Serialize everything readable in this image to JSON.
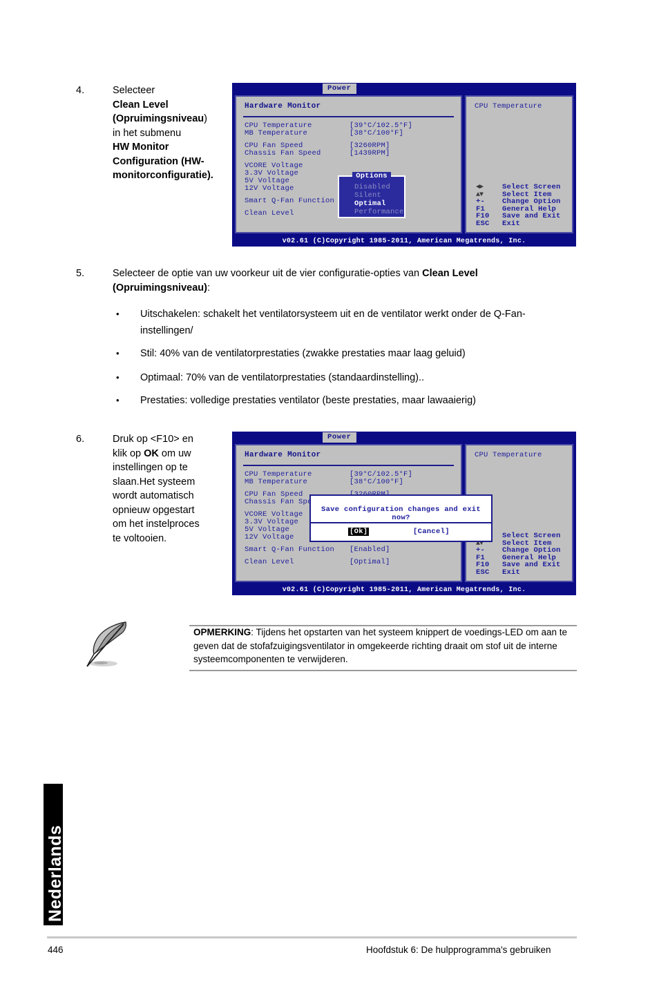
{
  "page": {
    "number": "446",
    "chapter": "Hoofdstuk 6: De hulpprogramma's gebruiken",
    "language_tab": "Nederlands"
  },
  "steps": {
    "step4": {
      "number": "4.",
      "line1": "Selecteer",
      "line2_bold": "Clean Level",
      "line3_bold": "(Opruimingsniveau",
      "line3_tail": ")",
      "line4": "in het submenu",
      "line5_bold": "HW Monitor",
      "line6_bold": "Configuration (HW-",
      "line7_bold": "monitorconfiguratie",
      "line7_tail": ")."
    },
    "step5": {
      "number": "5.",
      "text_pre": "Selecteer de optie van uw voorkeur uit de vier configuratie-opties van ",
      "text_bold1": "Clean Level",
      "text_bold2": "(Opruimingsniveau)",
      "text_post": ":",
      "bullets": [
        "Uitschakelen: schakelt het ventilatorsysteem uit en de ventilator werkt onder de Q-Fan-instellingen/",
        "Stil: 40% van de ventilatorprestaties (zwakke prestaties maar laag geluid)",
        "Optimaal: 70% van de ventilatorprestaties (standaardinstelling)..",
        "Prestaties: volledige prestaties ventilator (beste prestaties, maar lawaaierig)"
      ],
      "bullet_mark": "•"
    },
    "step6": {
      "number": "6.",
      "line1_pre": "Druk op <F10> en",
      "line2_pre": "klik op ",
      "line2_bold": "OK",
      "line2_post": " om uw",
      "line3": "instellingen op te",
      "line4": "slaan.Het systeem",
      "line5": "wordt automatisch",
      "line6": "opnieuw opgestart",
      "line7": "om het instelproces",
      "line8": "te voltooien."
    }
  },
  "note": {
    "label": "OPMERKING",
    "text": ": Tijdens het opstarten van het systeem knippert de voedings-LED om aan te geven dat de stofafzuigingsventilator in omgekeerde richting draait om stof uit de interne systeemcomponenten te verwijderen."
  },
  "bios": {
    "tab_label": "Power",
    "panel_title": "Hardware Monitor",
    "help_title": "CPU Temperature",
    "copyright": "v02.61 (C)Copyright 1985-2011, American Megatrends, Inc.",
    "monitor_rows": [
      {
        "label": "CPU Temperature",
        "value": "[39°C/102.5°F]"
      },
      {
        "label": "MB Temperature",
        "value": "[38°C/100°F]"
      },
      {
        "label": "CPU Fan Speed",
        "value": "[3260RPM]"
      },
      {
        "label": "Chassis Fan Speed",
        "value": "[1439RPM]"
      },
      {
        "label": "VCORE Voltage",
        "value": ""
      },
      {
        "label": "3.3V Voltage",
        "value": ""
      },
      {
        "label": "5V Voltage",
        "value": ""
      },
      {
        "label": "12V Voltage",
        "value": ""
      },
      {
        "label": "Smart Q-Fan Function",
        "value": "[Enabled]"
      },
      {
        "label": "Clean Level",
        "value": "[Optimal]"
      }
    ],
    "legend": [
      {
        "glyph": "◄►",
        "key": "",
        "text": "Select Screen"
      },
      {
        "glyph": "▲▼",
        "key": "",
        "text": "Select Item"
      },
      {
        "glyph": "",
        "key": "+-",
        "text": "Change Option"
      },
      {
        "glyph": "",
        "key": "F1",
        "text": "General Help"
      },
      {
        "glyph": "",
        "key": "F10",
        "text": "Save and Exit"
      },
      {
        "glyph": "",
        "key": "ESC",
        "text": "Exit"
      }
    ],
    "options_popup": {
      "title": "Options",
      "items": [
        {
          "label": "Disabled",
          "selected": false
        },
        {
          "label": "Silent",
          "selected": false
        },
        {
          "label": "Optimal",
          "selected": true
        },
        {
          "label": "Performance",
          "selected": false
        }
      ]
    },
    "save_dialog": {
      "message": "Save configuration changes and exit now?",
      "ok_label": "[Ok]",
      "cancel_label": "[Cancel]"
    }
  },
  "colors": {
    "bios_bar": "#0b0b86",
    "bios_panel": "#c0c0c0",
    "bios_text": "#1c1c9c",
    "popup_bg": "#2b2b9e",
    "popup_dim": "#8e8ec4",
    "accent_black": "#000000"
  }
}
